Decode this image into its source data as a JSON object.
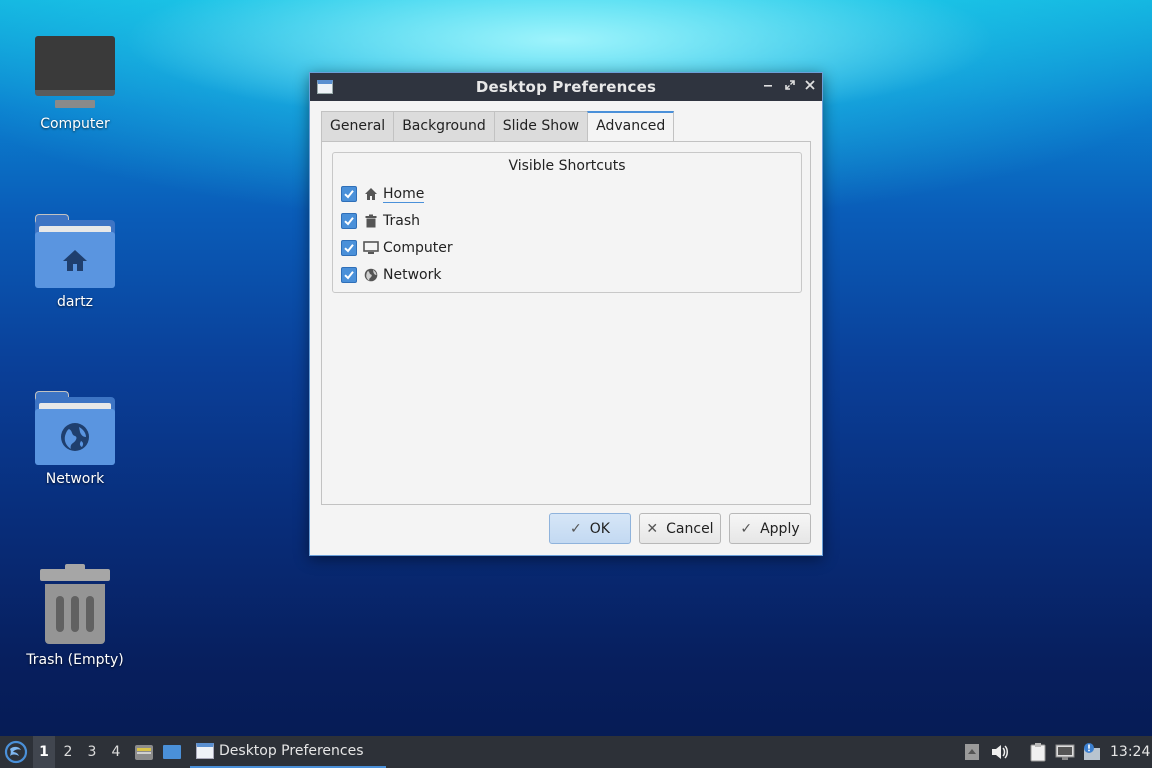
{
  "desktop": {
    "icons": [
      {
        "label": "Computer",
        "icon": "computer-icon"
      },
      {
        "label": "dartz",
        "icon": "home-folder-icon"
      },
      {
        "label": "Network",
        "icon": "network-folder-icon"
      },
      {
        "label": "Trash (Empty)",
        "icon": "trash-icon"
      }
    ]
  },
  "dialog": {
    "title": "Desktop Preferences",
    "window_controls": {
      "minimize": "minimize-icon",
      "maximize": "maximize-icon",
      "close": "close-icon"
    },
    "tabs": [
      {
        "label": "General",
        "active": false
      },
      {
        "label": "Background",
        "active": false
      },
      {
        "label": "Slide Show",
        "active": false
      },
      {
        "label": "Advanced",
        "active": true
      }
    ],
    "group_title": "Visible Shortcuts",
    "shortcuts": [
      {
        "label": "Home",
        "checked": true,
        "icon": "home-icon"
      },
      {
        "label": "Trash",
        "checked": true,
        "icon": "trash-icon"
      },
      {
        "label": "Computer",
        "checked": true,
        "icon": "monitor-icon"
      },
      {
        "label": "Network",
        "checked": true,
        "icon": "globe-icon"
      }
    ],
    "buttons": {
      "ok": "OK",
      "cancel": "Cancel",
      "apply": "Apply"
    }
  },
  "taskbar": {
    "desktops": [
      "1",
      "2",
      "3",
      "4"
    ],
    "active_desktop": "1",
    "task_label": "Desktop Preferences",
    "clock": "13:24"
  },
  "colors": {
    "accent": "#4a90d9",
    "titlebar": "#2f343f",
    "taskbar": "#2d3138"
  }
}
